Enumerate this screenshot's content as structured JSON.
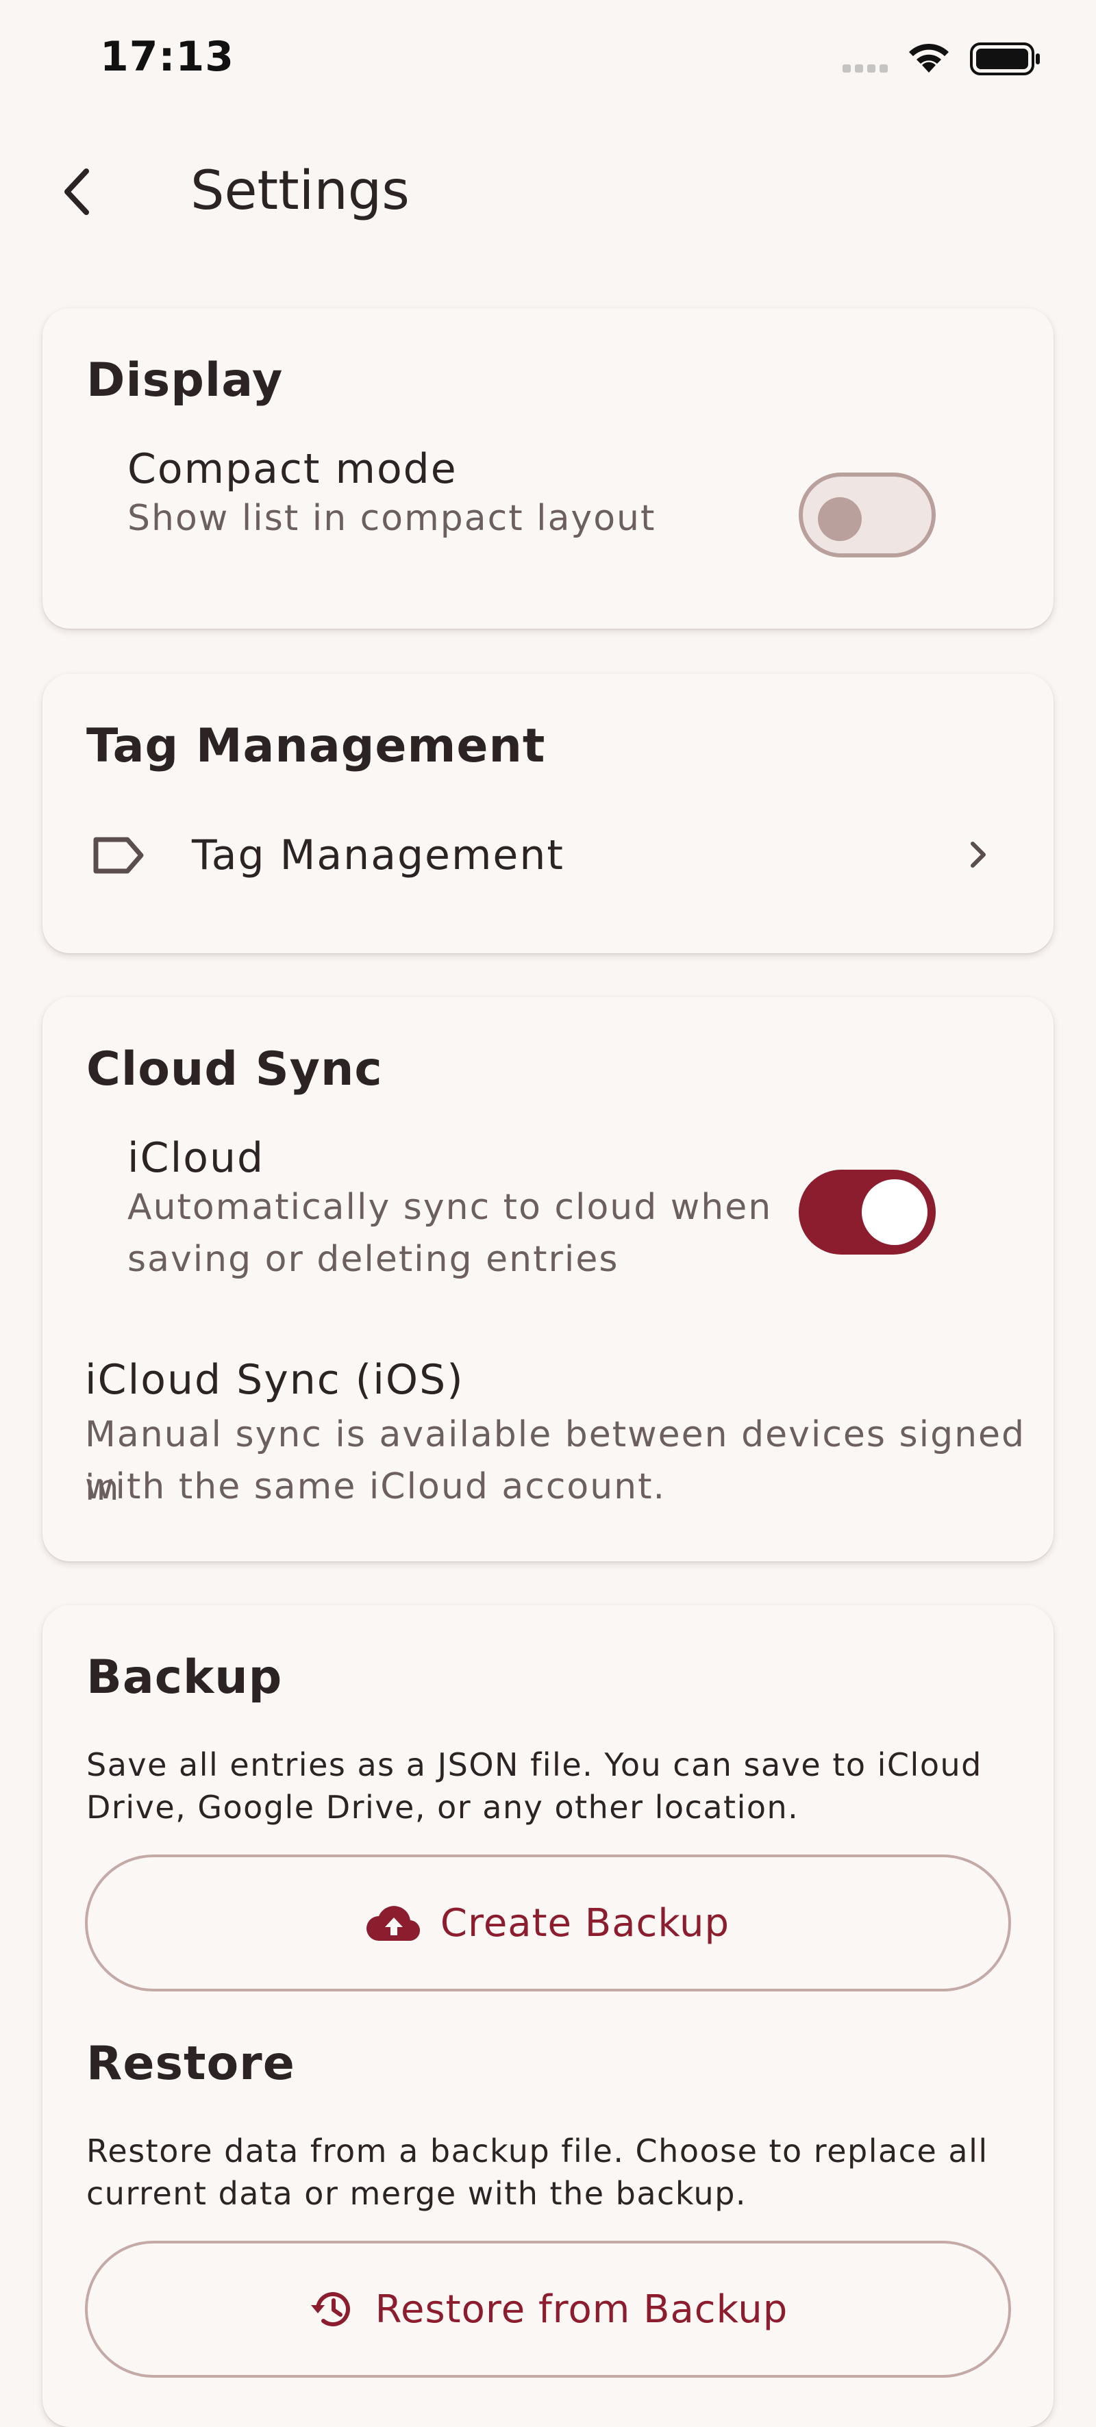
{
  "status_bar": {
    "time": "17:13",
    "icons": [
      "cellular-signal-icon",
      "wifi-icon",
      "battery-icon"
    ]
  },
  "header": {
    "back_icon": "chevron-left-icon",
    "title": "Settings"
  },
  "display": {
    "section_title": "Display",
    "compact_mode": {
      "title": "Compact mode",
      "subtitle": "Show list in compact layout",
      "enabled": false
    }
  },
  "tag_management": {
    "section_title": "Tag Management",
    "item_label": "Tag Management",
    "icon": "tag-icon",
    "trailing_icon": "chevron-right-icon"
  },
  "cloud_sync": {
    "section_title": "Cloud Sync",
    "icloud": {
      "title": "iCloud",
      "subtitle_line1": "Automatically sync to cloud when",
      "subtitle_line2": "saving or deleting entries",
      "enabled": true
    },
    "ios_sync": {
      "title": "iCloud Sync (iOS)",
      "description_line1": "Manual sync is available between devices signed in",
      "description_line2": "with the same iCloud account."
    }
  },
  "backup": {
    "section_title": "Backup",
    "description_line1": "Save all entries as a JSON file. You can save to iCloud",
    "description_line2": "Drive, Google Drive, or any other location.",
    "button_label": "Create Backup",
    "button_icon": "cloud-upload-icon"
  },
  "restore": {
    "section_title": "Restore",
    "description_line1": "Restore data from a backup file. Choose to replace all",
    "description_line2": "current data or merge with the backup.",
    "button_label": "Restore from Backup",
    "button_icon": "history-icon"
  },
  "colors": {
    "accent": "#8c1d2e",
    "background": "#faf6f4",
    "card": "#fbf7f5",
    "secondary_text": "#6b5f5f"
  }
}
